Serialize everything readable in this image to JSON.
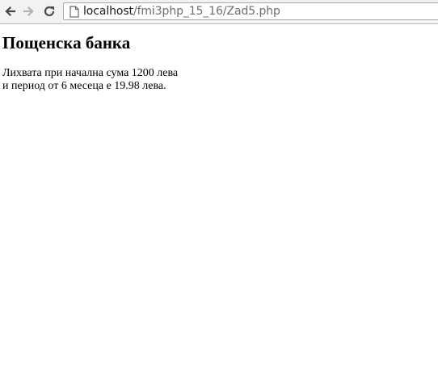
{
  "browser": {
    "url_host": "localhost",
    "url_path": "/fmi3php_15_16/Zad5.php",
    "icons": {
      "back": "back-arrow-icon",
      "forward": "forward-arrow-icon",
      "reload": "reload-icon",
      "page": "page-icon"
    }
  },
  "page": {
    "heading": "Пощенска банка",
    "line1": "Лихвата при начална сума 1200 лева",
    "line2": "и период от 6 месеца е 19.98 лева."
  }
}
